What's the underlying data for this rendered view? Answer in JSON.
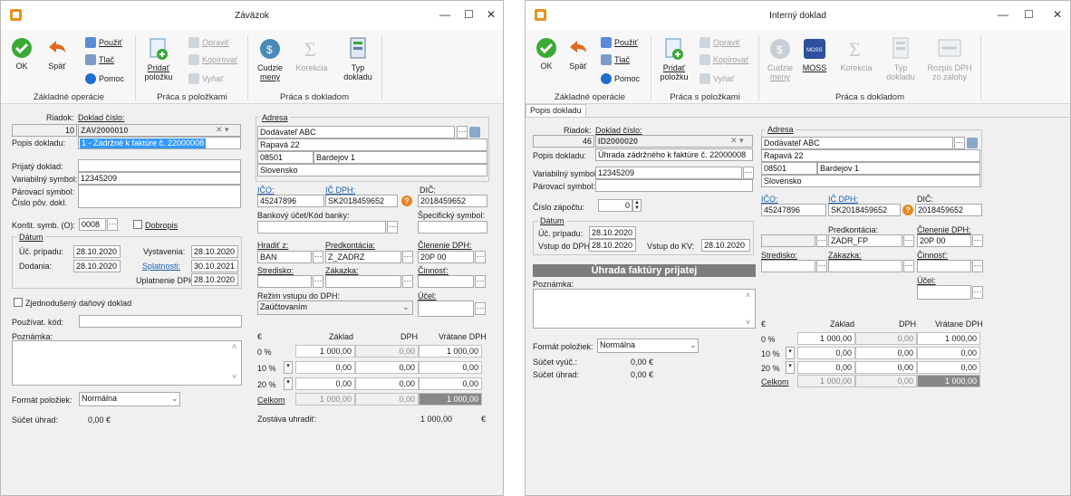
{
  "w1": {
    "title": "Záväzok",
    "ribbon": {
      "ok": "OK",
      "spat": "Späť",
      "pouzit": "Použiť",
      "tlac": "Tlač",
      "pomoc": "Pomoc",
      "pridat1": "Pridať",
      "pridat2": "položku",
      "opravit": "Opraviť",
      "kopirovat": "Kopírovať",
      "vynat": "Vyňať",
      "cudzie1": "Cudzie",
      "cudzie2": "meny",
      "korekcia": "Korekcia",
      "typ1": "Typ",
      "typ2": "dokladu",
      "grp1": "Základné operácie",
      "grp2": "Práca s položkami",
      "grp3": "Práca s dokladom"
    },
    "form": {
      "riadok_label": "Riadok:",
      "doklad_label": "Doklad číslo:",
      "riadok": "10",
      "doklad": "ZAV2000010",
      "popis_label": "Popis dokladu:",
      "popis": "1 - Zádržné k faktúre č. 22000008",
      "prijaty_label": "Prijatý doklad:",
      "vs_label": "Variabilný symbol:",
      "vs": "12345209",
      "parovaci_label": "Párovací symbol:",
      "cislo_pov_label": "Číslo pôv. dokl.",
      "konst_label": "Konšt. symb. (O):",
      "konst": "0008",
      "dobropis_label": "Dobropis",
      "datum_label": "Dátum",
      "uc_label": "Úč. prípadu:",
      "uc": "28.10.2020",
      "vyst_label": "Vystavenia:",
      "vyst": "28.10.2020",
      "dodania_label": "Dodania:",
      "dodania": "28.10.2020",
      "splat_label": "Splatnosti:",
      "splat": "30.10.2021",
      "upl_label": "Uplatnenie DPH:",
      "upl": "28.10.2020",
      "zjed_label": "Zjednodušený daňový doklad",
      "pouzivat_label": "Používat. kód:",
      "poznamka_label": "Poznámka:",
      "format_label": "Formát položiek:",
      "format": "Normálna",
      "sucet_label": "Súčet úhrad:",
      "sucet": "0,00  €"
    },
    "address": {
      "adresa_label": "Adresa",
      "name": "Dodávateľ ABC",
      "street": "Rapavá 22",
      "zip": "08501",
      "city": "Bardejov 1",
      "country": "Slovensko",
      "ico_label": "IČO:",
      "icdph_label": "IČ DPH:",
      "dic_label": "DIČ:",
      "ico": "45247896",
      "icdph": "SK2018459652",
      "dic": "2018459652",
      "bank_label": "Bankový účet/Kód banky:",
      "spec_label": "Špecifický symbol:",
      "hradit_label": "Hradiť z:",
      "hradit": "BAN",
      "predk_label": "Predkontácia:",
      "predk": "Z_ZADRZ",
      "clen_label": "Členenie DPH:",
      "clen": "20P 00",
      "stred_label": "Stredisko:",
      "zakazka_label": "Zákazka:",
      "cinnost_label": "Činnosť:",
      "rezim_label": "Režim vstupu do DPH:",
      "rezim": "Zaúčtovaním",
      "ucel_label": "Účel:"
    },
    "table": {
      "cur": "€",
      "h_zaklad": "Základ",
      "h_dph": "DPH",
      "h_vratane": "Vrátane DPH",
      "rows": [
        {
          "rate": "0 %",
          "zaklad": "1 000,00",
          "dph": "0,00",
          "spolu": "1 000,00"
        },
        {
          "rate": "10 %",
          "zaklad": "0,00",
          "dph": "0,00",
          "spolu": "0,00"
        },
        {
          "rate": "20 %",
          "zaklad": "0,00",
          "dph": "0,00",
          "spolu": "0,00"
        }
      ],
      "celkom_label": "Celkom",
      "celkom_zaklad": "1 000,00",
      "celkom_dph": "0,00",
      "celkom_spolu": "1 000,00",
      "zostava_label": "Zostáva uhradiť:",
      "zostava": "1 000,00",
      "zostava_cur": "€"
    }
  },
  "w2": {
    "title": "Interný doklad",
    "ribbon": {
      "ok": "OK",
      "spat": "Späť",
      "pouzit": "Použiť",
      "tlac": "Tlač",
      "pomoc": "Pomoc",
      "pridat1": "Pridať",
      "pridat2": "položku",
      "opravit": "Opraviť",
      "kopirovat": "Kopírovať",
      "vynat": "Vyňať",
      "cudzie1": "Cudzie",
      "cudzie2": "meny",
      "moss": "MOSS",
      "korekcia": "Korekcia",
      "typ1": "Typ",
      "typ2": "dokladu",
      "rozpis1": "Rozpis DPH",
      "rozpis2": "zo zálohy",
      "grp1": "Základné operácie",
      "grp2": "Práca s položkami",
      "grp3": "Práca s dokladom"
    },
    "tab": "Popis dokladu",
    "form": {
      "riadok_label": "Riadok:",
      "doklad_label": "Doklad číslo:",
      "riadok": "46",
      "doklad": "ID2000020",
      "popis_label": "Popis dokladu:",
      "popis": "Úhrada zádržného k faktúre č. 22000008",
      "vs_label": "Variabilný symbol:",
      "vs": "12345209",
      "parovaci_label": "Párovací symbol:",
      "zapoctu_label": "Číslo zápočtu:",
      "zapoctu": "0",
      "datum_label": "Dátum",
      "uc_label": "Úč. prípadu:",
      "uc": "28.10.2020",
      "vstup_label": "Vstup do DPH",
      "vstup": "28.10.2020",
      "kv_label": "Vstup do KV:",
      "kv": "28.10.2020",
      "bar": "Úhrada faktúry prijatej",
      "poznamka_label": "Poznámka:",
      "format_label": "Formát položiek:",
      "format": "Normálna",
      "vyuc_label": "Súčet vyúč.:",
      "vyuc": "0,00  €",
      "uhrad_label": "Súčet úhrad:",
      "uhrad": "0,00  €"
    },
    "address": {
      "adresa_label": "Adresa",
      "name": "Dodávateľ ABC",
      "street": "Rapavá 22",
      "zip": "08501",
      "city": "Bardejov 1",
      "country": "Slovensko",
      "ico_label": "IČO:",
      "icdph_label": "IČ DPH:",
      "dic_label": "DIČ:",
      "ico": "45247896",
      "icdph": "SK2018459652",
      "dic": "2018459652",
      "predk_label": "Predkontácia:",
      "predk": "ZADR_FP",
      "clen_label": "Členenie DPH:",
      "clen": "20P 00",
      "stred_label": "Stredisko:",
      "zakazka_label": "Zákazka:",
      "cinnost_label": "Činnosť:",
      "ucel_label": "Účel:"
    },
    "table": {
      "cur": "€",
      "h_zaklad": "Základ",
      "h_dph": "DPH",
      "h_vratane": "Vrátane DPH",
      "rows": [
        {
          "rate": "0 %",
          "zaklad": "1 000,00",
          "dph": "0,00",
          "spolu": "1 000,00"
        },
        {
          "rate": "10 %",
          "zaklad": "0,00",
          "dph": "0,00",
          "spolu": "0,00"
        },
        {
          "rate": "20 %",
          "zaklad": "0,00",
          "dph": "0,00",
          "spolu": "0,00"
        }
      ],
      "celkom_label": "Celkom",
      "celkom_zaklad": "1 000,00",
      "celkom_dph": "0,00",
      "celkom_spolu": "1 000,00"
    }
  },
  "colors": {
    "accent": "#1a5fb4",
    "ok_green": "#3aa935",
    "orange": "#e8861c",
    "bar_gray": "#7d7d7d"
  }
}
